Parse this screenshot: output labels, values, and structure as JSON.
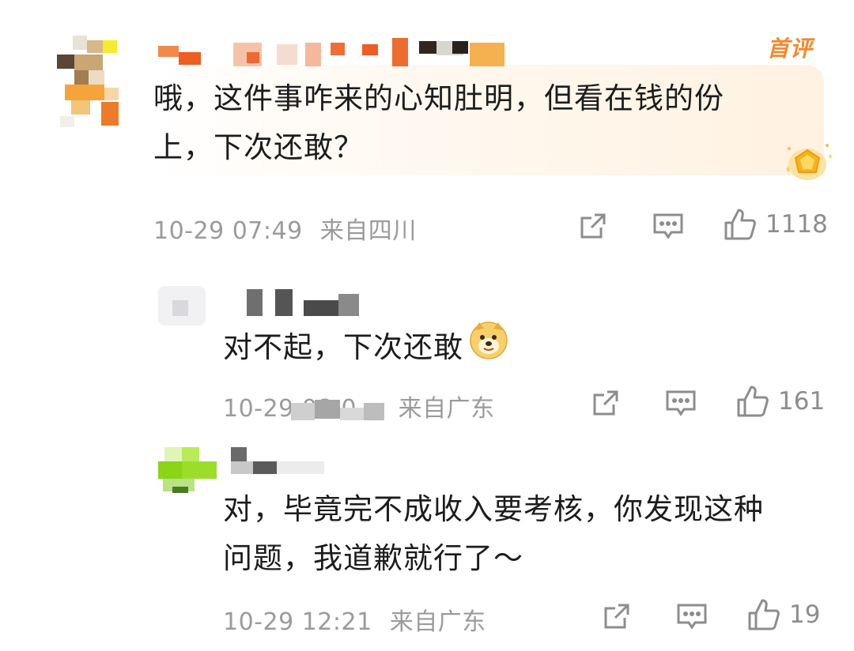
{
  "comments": [
    {
      "text_line1": "哦，这件事咋来的心知肚明，但看在钱的份",
      "text_line2": "上，下次还敢？",
      "badge": "首评",
      "timestamp": "10-29 07:49",
      "location": "来自四川",
      "likes": "1118"
    },
    {
      "text": "对不起，下次还敢",
      "emoji": "doge-emoji",
      "timestamp": "10-29 08:0…",
      "location": "来自广东",
      "likes": "161"
    },
    {
      "text_line1": "对，毕竟完不成收入要考核，你发现这种",
      "text_line2": "问题，我道歉就行了～",
      "timestamp": "10-29 12:21",
      "location": "来自广东",
      "likes": "19"
    }
  ],
  "icons": {
    "share": "share-icon",
    "comment": "comment-icon",
    "like": "thumbs-up-icon",
    "medal": "medal-icon"
  },
  "colors": {
    "accent": "#f2882f",
    "meta": "#9b9b9b",
    "icon": "#8d8d8d"
  }
}
